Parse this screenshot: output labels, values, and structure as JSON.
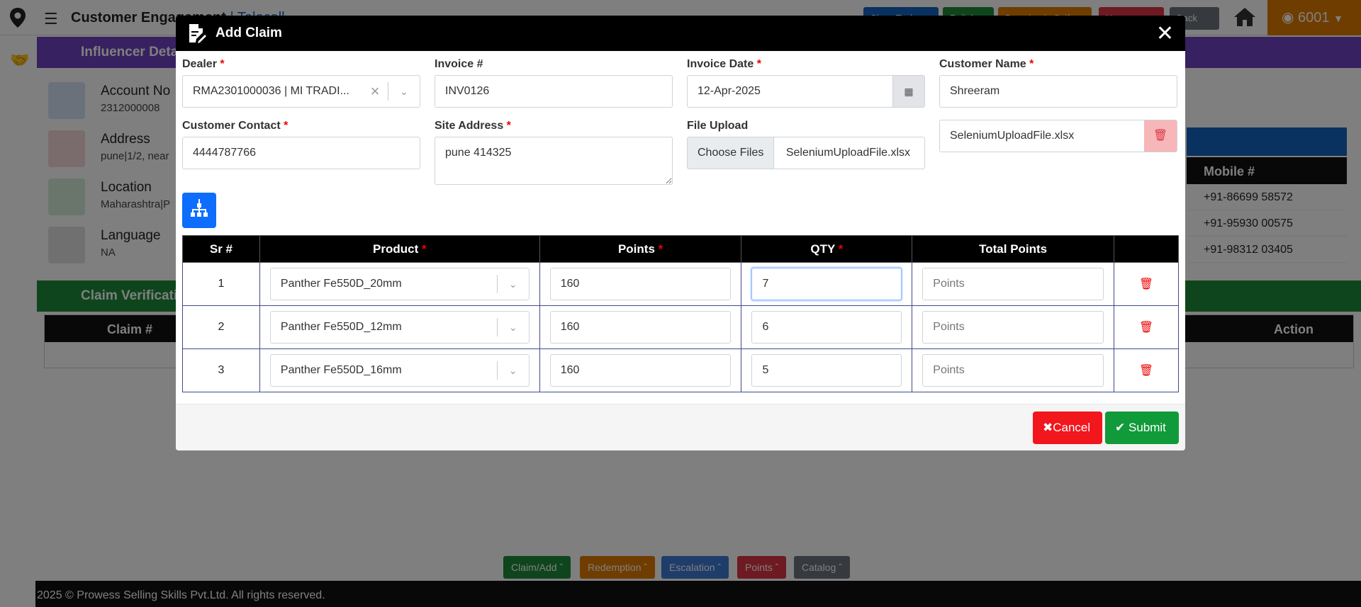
{
  "app": {
    "title": "Customer Engagement",
    "title_sub": "Telecall",
    "user_points": "6001",
    "top_buttons": [
      "Show Task",
      "Relink",
      "Download eSelf",
      "Home",
      "Back"
    ],
    "top_button_colors": [
      "#1565c0",
      "#1e8a3a",
      "#e07b00",
      "#dc3545",
      "#6c757d"
    ]
  },
  "background": {
    "influencer_title": "Influencer Details",
    "info": [
      {
        "label": "Account No",
        "value": "2312000008",
        "icon": "book-icon",
        "color": "#1565c0"
      },
      {
        "label": "Address",
        "value": "pune|1/2, near",
        "icon": "home-icon",
        "color": "#dc3545"
      },
      {
        "label": "Location",
        "value": "Maharashtra|P",
        "icon": "map-pin-icon",
        "color": "#1e8a3a"
      },
      {
        "label": "Language",
        "value": "NA",
        "icon": "translate-icon",
        "color": "#333333"
      }
    ],
    "mobile_header": "Mobile #",
    "mobiles": [
      "+91-86699 58572",
      "+91-95930 00575",
      "+91-98312 03405"
    ],
    "claim_verification_title": "Claim Verification",
    "verif_headers": {
      "claim": "Claim #",
      "action": "Action"
    },
    "bottom_buttons": [
      "Claim/Add",
      "Redemption",
      "Escalation",
      "Points",
      "Catalog"
    ],
    "bottom_button_colors": [
      "#1e8a3a",
      "#e07b00",
      "#3d7bd6",
      "#dc3545",
      "#6c757d"
    ],
    "footer": "2025 © Prowess Selling Skills Pvt.Ltd. All rights reserved."
  },
  "modal": {
    "title": "Add Claim",
    "fields": {
      "dealer": {
        "label": "Dealer",
        "value": "RMA2301000036 | MI TRADI..."
      },
      "invoice_no": {
        "label": "Invoice #",
        "value": "INV0126"
      },
      "invoice_date": {
        "label": "Invoice Date",
        "value": "12-Apr-2025"
      },
      "customer_name": {
        "label": "Customer Name",
        "value": "Shreeram"
      },
      "customer_contact": {
        "label": "Customer Contact",
        "value": "4444787766"
      },
      "site_address": {
        "label": "Site Address",
        "value": "pune 414325"
      },
      "file_upload": {
        "label": "File Upload",
        "button": "Choose Files",
        "file": "SeleniumUploadFile.xlsx"
      },
      "uploaded_file": "SeleniumUploadFile.xlsx"
    },
    "table": {
      "headers": [
        "Sr #",
        "Product",
        "Points",
        "QTY",
        "Total Points"
      ],
      "rows": [
        {
          "sr": "1",
          "product": "Panther Fe550D_20mm",
          "points": "160",
          "qty": "7",
          "total_placeholder": "Points"
        },
        {
          "sr": "2",
          "product": "Panther Fe550D_12mm",
          "points": "160",
          "qty": "6",
          "total_placeholder": "Points"
        },
        {
          "sr": "3",
          "product": "Panther Fe550D_16mm",
          "points": "160",
          "qty": "5",
          "total_placeholder": "Points"
        }
      ]
    },
    "buttons": {
      "cancel": "Cancel",
      "submit": "Submit"
    },
    "colors": {
      "cancel": "#f2161d",
      "submit": "#119a3a",
      "add": "#0d6efd"
    }
  }
}
